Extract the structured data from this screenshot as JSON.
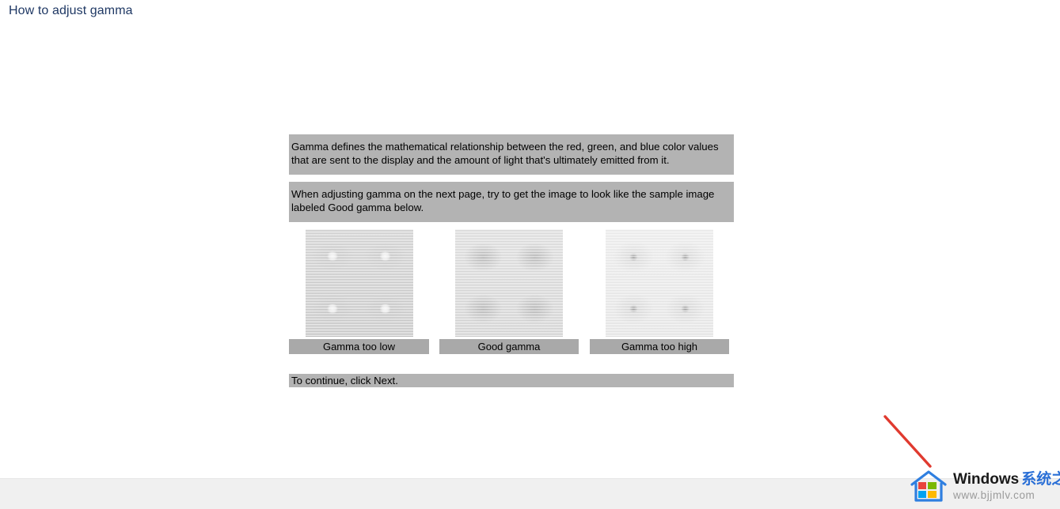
{
  "page_title": "How to adjust gamma",
  "wizard": {
    "paragraph_1": "Gamma defines the mathematical relationship between the red, green, and blue color values that are sent to the display and the amount of light that's ultimately emitted from it.",
    "paragraph_2": "When adjusting gamma on the next page, try to get the image to look like the sample image labeled Good gamma below.",
    "continue_text": "To continue, click Next.",
    "samples": [
      {
        "label": "Gamma too low",
        "name": "gamma-too-low"
      },
      {
        "label": "Good gamma",
        "name": "good-gamma"
      },
      {
        "label": "Gamma too high",
        "name": "gamma-too-high"
      }
    ]
  },
  "watermark": {
    "brand": "Windows",
    "brand_cn": "系统之家",
    "url": "www.bjjmlv.com"
  },
  "colors": {
    "title": "#1f3864",
    "paragraph_bg": "#b3b3b3",
    "label_bg": "#a9a9a9",
    "arrow": "#e03a2f",
    "brand_cn": "#2a6fd6",
    "footer_bg": "#f0f0f0"
  }
}
